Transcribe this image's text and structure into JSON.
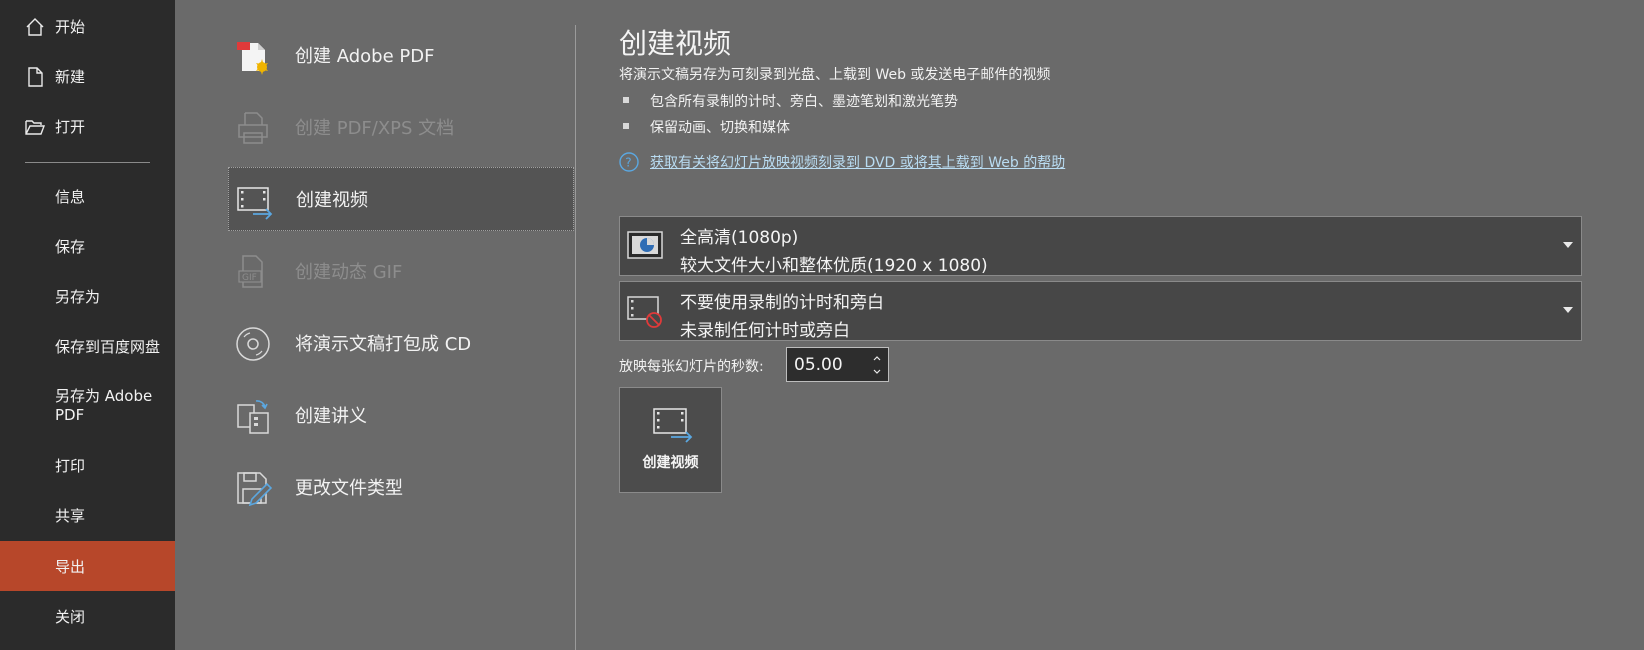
{
  "nav": {
    "home": "开始",
    "new": "新建",
    "open": "打开",
    "info": "信息",
    "save": "保存",
    "save_as": "另存为",
    "save_to_baidu": "保存到百度网盘",
    "save_as_adobe": "另存为 Adobe PDF",
    "print": "打印",
    "share": "共享",
    "export": "导出",
    "close": "关闭",
    "active_color": "#b7472a"
  },
  "options": {
    "create_adobe_pdf": "创建 Adobe PDF",
    "create_pdf_xps": "创建 PDF/XPS 文档",
    "create_video": "创建视频",
    "create_gif": "创建动态 GIF",
    "package_cd": "将演示文稿打包成 CD",
    "create_handouts": "创建讲义",
    "change_file_type": "更改文件类型"
  },
  "panel": {
    "title": "创建视频",
    "description": "将演示文稿另存为可刻录到光盘、上载到 Web 或发送电子邮件的视频",
    "bullets": [
      "包含所有录制的计时、旁白、墨迹笔划和激光笔势",
      "保留动画、切换和媒体"
    ],
    "help_link": "获取有关将幻灯片放映视频刻录到 DVD 或将其上载到 Web 的帮助",
    "quality": {
      "title": "全高清(1080p)",
      "subtitle": "较大文件大小和整体优质(1920 x 1080)"
    },
    "timings": {
      "title": "不要使用录制的计时和旁白",
      "subtitle": "未录制任何计时或旁白"
    },
    "seconds_label": "放映每张幻灯片的秒数:",
    "seconds_value": "05.00",
    "create_button": "创建视频"
  }
}
